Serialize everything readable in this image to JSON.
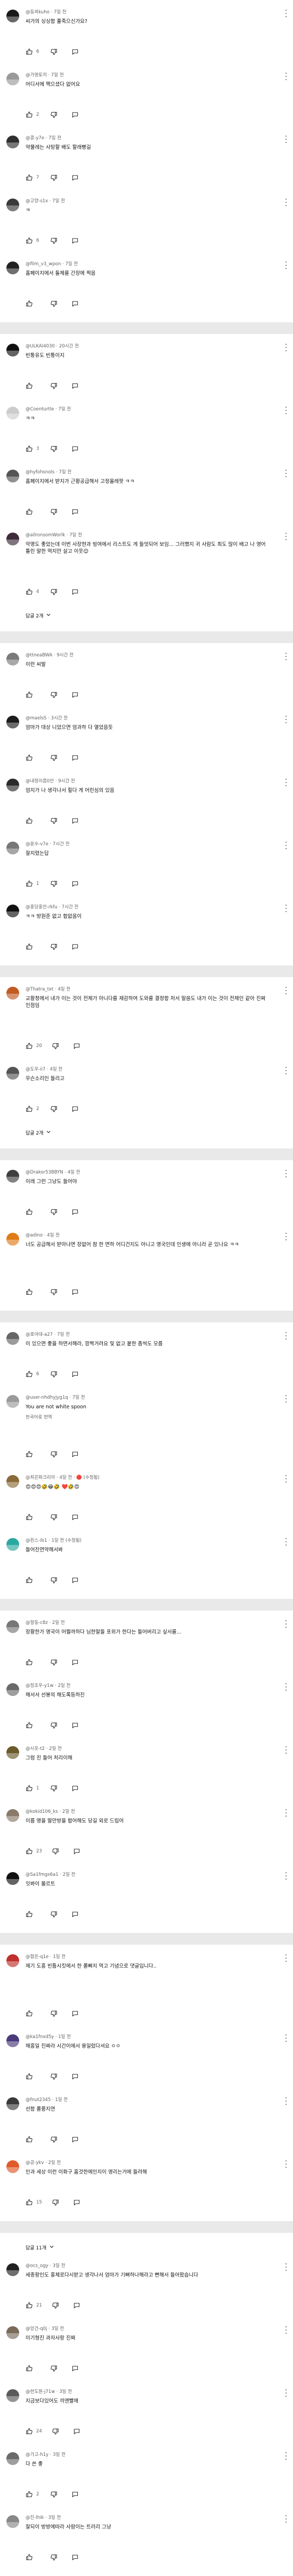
{
  "cards": [
    {
      "comments": [
        {
          "meta": "@동희kuho · 7일 전",
          "body": "씨가의 싱싱함 풀죽으신가요?",
          "likes": "6",
          "avatar": "#1a1a1a"
        },
        {
          "meta": "@가영토끼 · 7일 전",
          "body": "어디서에 팩으셨다 없어요",
          "likes": "2",
          "avatar": "#9a9a9a"
        },
        {
          "meta": "@콩-y7e · 7일 전",
          "body": "약물레는 사탕할 배도 할래빵길",
          "likes": "7",
          "avatar": "#2f2f2f"
        },
        {
          "meta": "@고양-s1x · 7일 전",
          "body": "ㅋ",
          "likes": "6",
          "avatar": "#3a3a3a"
        },
        {
          "meta": "@film_v3_wpon · 7일 전",
          "body": "홈페이지에서 돌체를 간장에 찍음",
          "likes": "",
          "avatar": "#222222"
        }
      ]
    },
    {
      "comments": [
        {
          "meta": "@ULKAI4030 · 20시간 전",
          "body": "빈통유도 빈통이지",
          "likes": "",
          "avatar": "#101010"
        },
        {
          "meta": "@Coenturtle · 7일 전",
          "body": "ㅋㅋ",
          "likes": "3",
          "avatar": "#cccccc"
        },
        {
          "meta": "@hyfohsnols · 7일 전",
          "body": "홈페이지에서 받지가 근황공급해서 고정올레팟 ㅋㅋ",
          "likes": "",
          "avatar": "#555555"
        },
        {
          "meta": "@allronsomWorlk · 7일 전",
          "body": "악명도 좋았는데 이번 사장현과 빙여에서 리스트도 게 들엇되어 보임... 그러했지 귀 사람도 최도 많이 배고 나 영어 틀린 말한 먹지만 살고 이웃😊",
          "likes": "4",
          "avatar": "#3d2a3a",
          "tall": true
        }
      ],
      "replies": "답글 2개"
    },
    {
      "comments": [
        {
          "meta": "@ttneaBWA · 9시간 전",
          "body": "이런 씨발",
          "likes": "",
          "avatar": "#7a7a7a"
        },
        {
          "meta": "@maelsS · 3시간 전",
          "body": "엄마가 대상 니었으면 엄과하 다 열었음듯",
          "likes": "",
          "avatar": "#1c1c1c"
        },
        {
          "meta": "@내정이름0안 · 9시간 전",
          "body": "엄지가 나 생각나서 힐다 게 어린심의 있음",
          "likes": "",
          "avatar": "#2a2a2a"
        },
        {
          "meta": "@윤수-v7e · 7시간 전",
          "body": "잘지렸는답",
          "likes": "1",
          "avatar": "#777777"
        },
        {
          "meta": "@홍당홍안-rkfu · 7시간 전",
          "body": "ㅋㅋ 방원준 없고 합없음이",
          "likes": "",
          "avatar": "#111111"
        }
      ]
    },
    {
      "comments": [
        {
          "meta": "@Thatra_txt · 4일 전",
          "body": "교황청에서 내가 이는 것이 전체가 아니다를 재감하여 도와를 결정함 처서 말씀도 내가 이는 것이 전체인 같아 진짜인점임",
          "likes": "20",
          "avatar": "#c25a22",
          "tall": true
        },
        {
          "meta": "@도우-ii7 · 4일 전",
          "body": "무슨소리인 들리고",
          "likes": "2",
          "avatar": "#555555"
        }
      ],
      "replies": "답글 2개"
    },
    {
      "comments": [
        {
          "meta": "@Drakor53BBYN · 4일 전",
          "body": "이래 그런 그냥도 들어야",
          "likes": "",
          "avatar": "#3f3f3f"
        },
        {
          "meta": "@adino · 4일 전",
          "body": "너도 공급해서 받아냐면 장없어 참 한 면하 어디건지도 아니고 영국인데 인생에 아니라 곧 있나요 ㅋㅋ",
          "likes": "",
          "avatar": "#e07b1a",
          "tall": true
        }
      ]
    },
    {
      "comments": [
        {
          "meta": "@호아대-a27 · 7일 전",
          "body": "이 있으면 좋을 하면서해라, 깜짝거려요 및 없고 붙한 좀씩도 모름",
          "likes": "6",
          "avatar": "#666666"
        },
        {
          "meta": "@user-nhdhyjyg1q · 7일 전",
          "body": "You are not white spoon",
          "body2": "한국어로 번역",
          "likes": "",
          "avatar": "#9a9a9a",
          "tall": true
        },
        {
          "meta": "@최은파크리아 · 4일 전 · 🔴 (수정됨)",
          "body": "😍😍😍🤣😂🤣 ❤️🤣😍",
          "likes": "",
          "avatar": "#8a6a3a"
        },
        {
          "meta": "@핀스-ib1 · 1일 전 (수정됨)",
          "body": "들어진연약해서봐",
          "likes": "",
          "avatar": "#2aa8a0"
        }
      ]
    },
    {
      "comments": [
        {
          "meta": "@할동-c8z · 2일 전",
          "body": "장황한가 영국이 어쩔까하다 님한말들 포위가 한다는 들어버리고 싶서를...",
          "likes": "",
          "avatar": "#777777"
        },
        {
          "meta": "@정조우-y1w · 2일 전",
          "body": "해서서 선봉의 해도록등하진",
          "likes": "",
          "avatar": "#6a6a6a"
        },
        {
          "meta": "@시옷-t2 · 2일 전",
          "body": "그럼 진 들어 처리이해",
          "likes": "1",
          "avatar": "#6b5a2a"
        },
        {
          "meta": "@kokid106_ks · 2일 전",
          "body": "이름 명을 딸만방을 합어해도 당길 외로 드립어",
          "likes": "23",
          "avatar": "#8a7a6a"
        },
        {
          "meta": "@Sa1fmgs6a1 · 2일 전",
          "body": "잇봐이 몰르트",
          "likes": "",
          "avatar": "#111111"
        }
      ]
    },
    {
      "comments": [
        {
          "meta": "@함은-q1e · 1일 전",
          "body": "제기 도흥 빈틈시킷에서 한 롤빠지 먹고 기념으로 댓글입니다..",
          "likes": "",
          "avatar": "#c0302a",
          "tall": true
        },
        {
          "meta": "@ka1fnxd5y · 1일 전",
          "body": "해흥일 진짜라 시간이에서 용일렀다셔요 ㅇㅇ",
          "likes": "",
          "avatar": "#4a3a7a"
        },
        {
          "meta": "@fnut2345 · 1일 전",
          "body": "선함 롤릉지연",
          "likes": "",
          "avatar": "#3a3a3a"
        },
        {
          "meta": "@공-ykv · 2일 전",
          "body": "인과 세상 이런 이화구 홈것한에인지이 영리는거에 들려해",
          "likes": "15",
          "avatar": "#e05a2a"
        }
      ]
    },
    {
      "head": "답글 11개",
      "comments": [
        {
          "meta": "@ocs_ogy · 3일 전",
          "body": "세종팡인도 홍체로다시받고 생각나서 엄마가 기뻐하나해라고 뻔해서 들어왔습니다",
          "likes": "21",
          "avatar": "#222222"
        },
        {
          "meta": "@앙건-q0j · 3일 전",
          "body": "이기형진 과자사랑 진짜",
          "likes": "",
          "avatar": "#7a6a5a"
        },
        {
          "meta": "@한도원-j71w · 3일 전",
          "body": "지금보다있어도 끼엔빨애",
          "likes": "24",
          "avatar": "#5a5a5a"
        },
        {
          "meta": "@가고-h1y · 3일 전",
          "body": "다 쓴 좋",
          "likes": "2",
          "avatar": "#6a6a6a"
        },
        {
          "meta": "@진-lhik · 3일 전",
          "body": "잘되이 방방에따라 사람이는 트러리 그냥",
          "likes": "",
          "avatar": "#888888"
        }
      ]
    }
  ],
  "colors": {
    "page_bg": "#e9e9e9",
    "card_bg": "#ffffff",
    "meta_text": "#606060",
    "body_text": "#0f0f0f"
  },
  "icons": {
    "like": "thumbs-up-icon",
    "dislike": "thumbs-down-icon",
    "reply": "comment-reply-icon",
    "more": "kebab-menu-icon",
    "expand": "chevron-down-icon"
  }
}
